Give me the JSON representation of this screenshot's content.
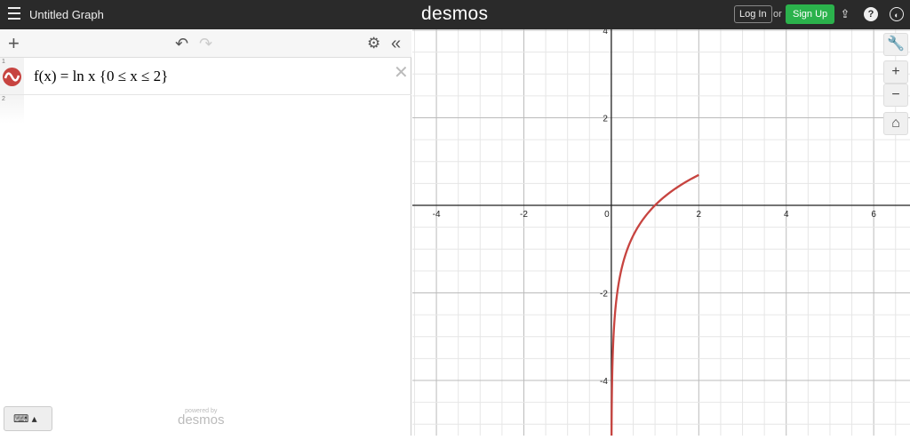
{
  "header": {
    "title": "Untitled Graph",
    "logo": "desmos",
    "login": "Log In",
    "or": "or",
    "signup": "Sign Up",
    "icons": [
      "share-icon",
      "help-icon",
      "globe-icon"
    ]
  },
  "toolbar": {
    "add": "+",
    "undo": "↶",
    "redo": "↷",
    "settings": "⚙",
    "collapse": "«"
  },
  "expressions": [
    {
      "num": "1",
      "latex": "f(x) = ln x {0 ≤ x ≤ 2}",
      "color": "#c74440"
    },
    {
      "num": "2",
      "latex": ""
    }
  ],
  "footer": {
    "keyboard": "⌨ ▴",
    "powered_by": "powered by",
    "brand": "desmos"
  },
  "graph_controls": {
    "wrench": "🔧",
    "zoom_in": "+",
    "zoom_out": "−",
    "home": "⌂"
  },
  "chart_data": {
    "type": "line",
    "function": "ln(x)",
    "domain": [
      0,
      2
    ],
    "xlim": [
      -4.55,
      6.83
    ],
    "ylim": [
      -5.26,
      4.02
    ],
    "x_ticks": [
      -4,
      -2,
      0,
      2,
      4,
      6
    ],
    "y_ticks": [
      -4,
      -2,
      2,
      4
    ],
    "x_tick_labels": [
      "-4",
      "-2",
      "0",
      "2",
      "4",
      "6"
    ],
    "y_tick_labels": [
      "-4",
      "-2",
      "2",
      "4"
    ],
    "grid": true,
    "color": "#c74440"
  }
}
